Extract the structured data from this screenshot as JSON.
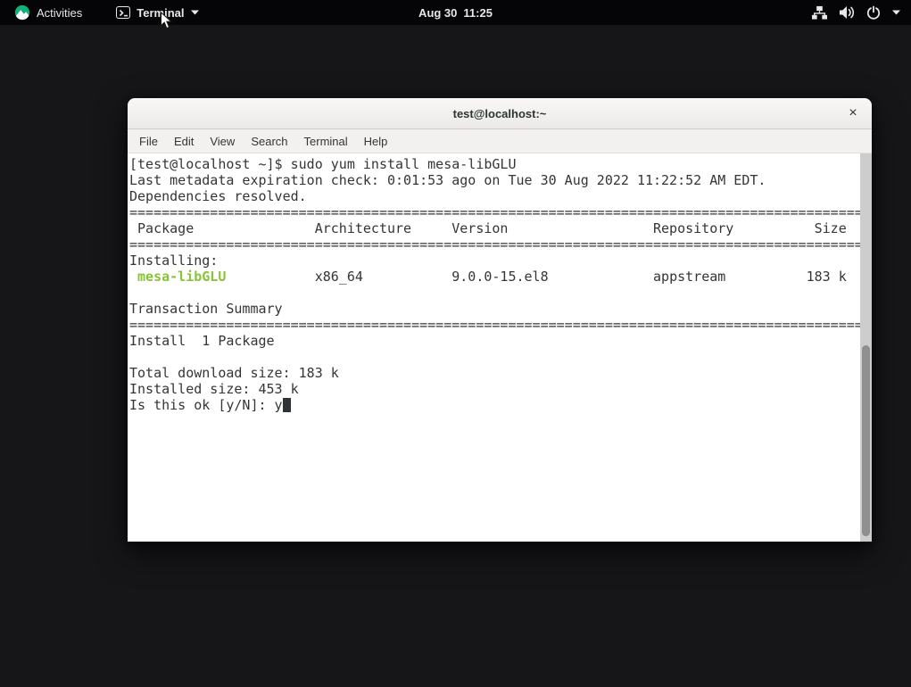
{
  "colors": {
    "package_green": "#87c437",
    "terminal_bg": "#ffffff",
    "terminal_fg": "#353535",
    "top_bar_bg": "#050507",
    "desktop_bg": "#161619",
    "rocky_green": "#12b07a"
  },
  "top_bar": {
    "activities": "Activities",
    "app_button": {
      "label": "Terminal"
    },
    "clock": {
      "date": "Aug 30",
      "time": "11:25"
    }
  },
  "window": {
    "title": "test@localhost:~",
    "close_label": "×",
    "menu_items": [
      "File",
      "Edit",
      "View",
      "Search",
      "Terminal",
      "Help"
    ]
  },
  "terminal": {
    "separator": {
      "char": "=",
      "count": 91
    },
    "lines": [
      {
        "text": "[test@localhost ~]$ sudo yum install mesa-libGLU"
      },
      {
        "text": "Last metadata expiration check: 0:01:53 ago on Tue 30 Aug 2022 11:22:52 AM EDT."
      },
      {
        "text": "Dependencies resolved."
      },
      {
        "type": "separator"
      },
      {
        "text": " Package               Architecture     Version                  Repository          Size"
      },
      {
        "type": "separator"
      },
      {
        "text": "Installing:"
      },
      {
        "segments": [
          {
            "text": " "
          },
          {
            "text": "mesa-libGLU",
            "style": "package"
          },
          {
            "text": "           x86_64           9.0.0-15.el8             appstream          183 k"
          }
        ]
      },
      {
        "text": ""
      },
      {
        "text": "Transaction Summary"
      },
      {
        "type": "separator"
      },
      {
        "text": "Install  1 Package"
      },
      {
        "text": ""
      },
      {
        "text": "Total download size: 183 k"
      },
      {
        "text": "Installed size: 453 k"
      },
      {
        "text": "Is this ok [y/N]: y",
        "cursor": true
      }
    ],
    "package_table": {
      "headers": [
        "Package",
        "Architecture",
        "Version",
        "Repository",
        "Size"
      ],
      "rows": [
        [
          "mesa-libGLU",
          "x86_64",
          "9.0.0-15.el8",
          "appstream",
          "183 k"
        ]
      ]
    }
  }
}
